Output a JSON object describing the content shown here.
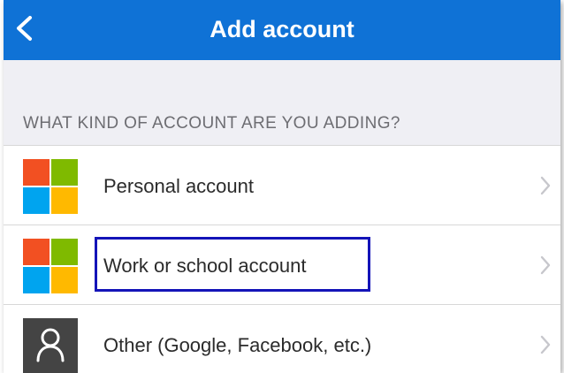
{
  "header": {
    "title": "Add account",
    "back_icon": "chevron-left-icon",
    "background": "#0f72d6"
  },
  "section": {
    "header": "WHAT KIND OF ACCOUNT ARE YOU ADDING?"
  },
  "accounts": [
    {
      "label": "Personal account",
      "icon": "microsoft-logo-icon"
    },
    {
      "label": "Work or school account",
      "icon": "microsoft-logo-icon",
      "highlighted": true
    },
    {
      "label": "Other (Google, Facebook, etc.)",
      "icon": "person-icon"
    }
  ],
  "colors": {
    "ms_red": "#f25022",
    "ms_green": "#7fba00",
    "ms_blue": "#00a4ef",
    "ms_yellow": "#ffb900",
    "highlight_border": "#1414b8",
    "other_icon_bg": "#444444"
  }
}
